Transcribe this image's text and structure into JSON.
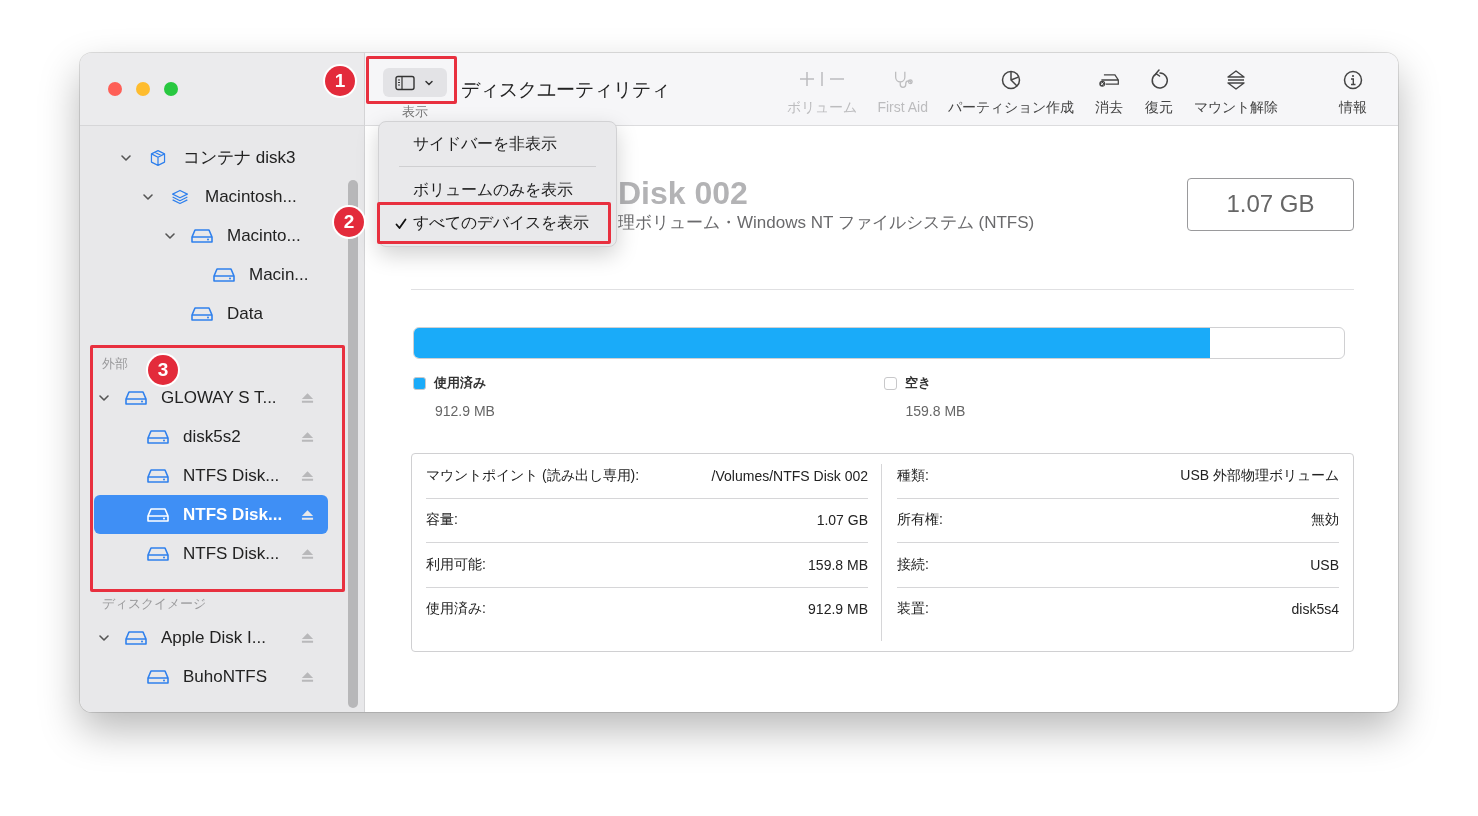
{
  "window": {
    "title": "ディスクユーティリティ"
  },
  "toolbar": {
    "view_button": {
      "label": "表示"
    },
    "tools": [
      {
        "label": "ボリューム",
        "disabled": true
      },
      {
        "label": "First Aid",
        "disabled": true
      },
      {
        "label": "パーティション作成",
        "disabled": false
      },
      {
        "label": "消去",
        "disabled": false
      },
      {
        "label": "復元",
        "disabled": false
      },
      {
        "label": "マウント解除",
        "disabled": false
      },
      {
        "label": "情報",
        "disabled": false
      }
    ]
  },
  "view_menu": [
    {
      "kind": "item",
      "label": "サイドバーを非表示",
      "checked": false
    },
    {
      "kind": "separator"
    },
    {
      "kind": "item",
      "label": "ボリュームのみを表示",
      "checked": false
    },
    {
      "kind": "item",
      "label": "すべてのデバイスを表示",
      "checked": true
    }
  ],
  "sidebar": {
    "sections": [
      {
        "items": [
          {
            "label": "コンテナ disk3",
            "kind": "container",
            "expanded": true,
            "selected": false,
            "eject": false,
            "children": [
              {
                "label": "Macintosh...",
                "kind": "group",
                "expanded": true,
                "selected": false,
                "eject": false,
                "children": [
                  {
                    "label": "Macinto...",
                    "kind": "drive",
                    "expanded": true,
                    "selected": false,
                    "eject": false,
                    "children": [
                      {
                        "label": "Macin...",
                        "kind": "drive",
                        "selected": false,
                        "eject": false
                      }
                    ]
                  },
                  {
                    "label": "Data",
                    "kind": "drive",
                    "selected": false,
                    "eject": false
                  }
                ]
              }
            ]
          }
        ]
      },
      {
        "label": "外部",
        "items": [
          {
            "label": "GLOWAY S T...",
            "kind": "drive",
            "expanded": true,
            "selected": false,
            "eject": true,
            "children": [
              {
                "label": "disk5s2",
                "kind": "drive",
                "selected": false,
                "eject": true
              },
              {
                "label": "NTFS Disk...",
                "kind": "drive",
                "selected": false,
                "eject": true
              },
              {
                "label": "NTFS Disk...",
                "kind": "drive",
                "selected": true,
                "eject": true
              },
              {
                "label": "NTFS Disk...",
                "kind": "drive",
                "selected": false,
                "eject": true
              }
            ]
          }
        ]
      },
      {
        "label": "ディスクイメージ",
        "items": [
          {
            "label": "Apple Disk I...",
            "kind": "drive",
            "expanded": true,
            "selected": false,
            "eject": true,
            "children": [
              {
                "label": "BuhoNTFS",
                "kind": "drive",
                "selected": false,
                "eject": true
              }
            ]
          }
        ]
      }
    ]
  },
  "volume": {
    "title": "Disk 002",
    "subtitle": "理ボリューム・Windows NT ファイルシステム (NTFS)",
    "capacity": "1.07 GB",
    "usage": {
      "level": 0.856
    },
    "legend": [
      {
        "label": "使用済み",
        "value": "912.9 MB",
        "color": "#1aabf9"
      },
      {
        "label": "空き",
        "value": "159.8 MB",
        "color": "#ffffff"
      }
    ],
    "info": [
      [
        {
          "label": "マウントポイント (読み出し専用):",
          "value": "/Volumes/NTFS Disk 002"
        },
        {
          "label": "容量:",
          "value": "1.07 GB"
        },
        {
          "label": "利用可能:",
          "value": "159.8 MB"
        },
        {
          "label": "使用済み:",
          "value": "912.9 MB"
        }
      ],
      [
        {
          "label": "種類:",
          "value": "USB 外部物理ボリューム"
        },
        {
          "label": "所有権:",
          "value": "無効"
        },
        {
          "label": "接続:",
          "value": "USB"
        },
        {
          "label": "装置:",
          "value": "disk5s4"
        }
      ]
    ]
  },
  "annotations": [
    {
      "label": "1"
    },
    {
      "label": "2"
    },
    {
      "label": "3"
    }
  ]
}
